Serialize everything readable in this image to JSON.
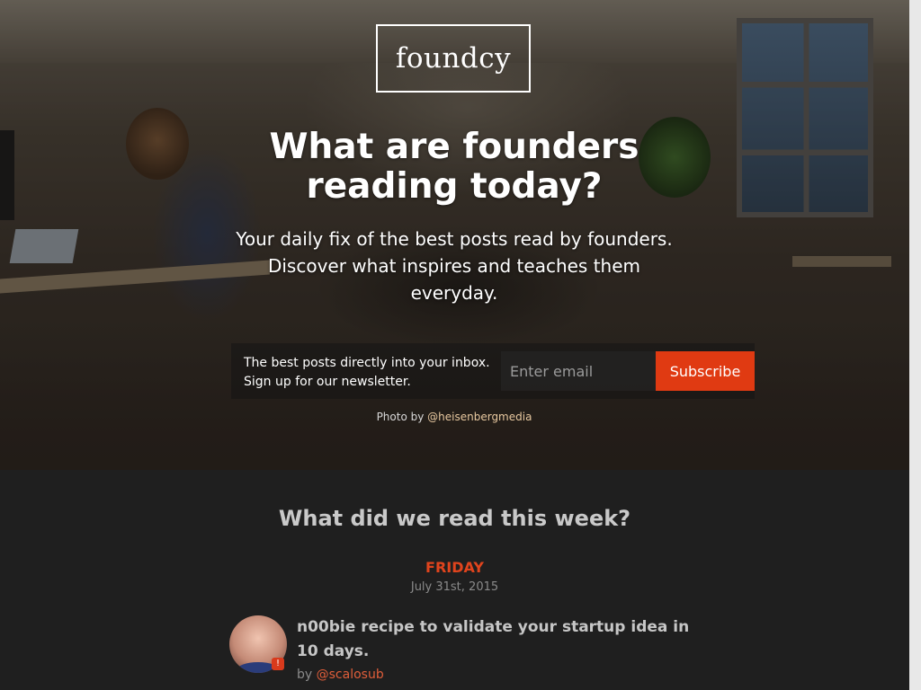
{
  "brand": {
    "logo_text": "foundcy"
  },
  "hero": {
    "headline": "What are founders reading today?",
    "subhead": "Your daily fix of the best posts read by founders. Discover what inspires and teaches them everyday.",
    "signup": {
      "line1": "The best posts directly into your inbox.",
      "line2": "Sign up for our newsletter.",
      "email_placeholder": "Enter email",
      "subscribe_label": "Subscribe"
    },
    "credit": {
      "prefix": "Photo by",
      "handle": "@heisenbergmedia"
    }
  },
  "weekly": {
    "title": "What did we read this week?",
    "days": [
      {
        "day": "FRIDAY",
        "date": "July 31st, 2015",
        "posts": [
          {
            "title": "n00bie recipe to validate your startup idea in 10 days.",
            "by_prefix": "by",
            "author": "@scalosub"
          }
        ]
      }
    ]
  },
  "colors": {
    "accent": "#e03a12",
    "background": "#1f1f1f",
    "day_label": "#e0441d",
    "author_link": "#e05e3a"
  },
  "icons": {
    "avatar_badge": "source-badge-icon"
  }
}
